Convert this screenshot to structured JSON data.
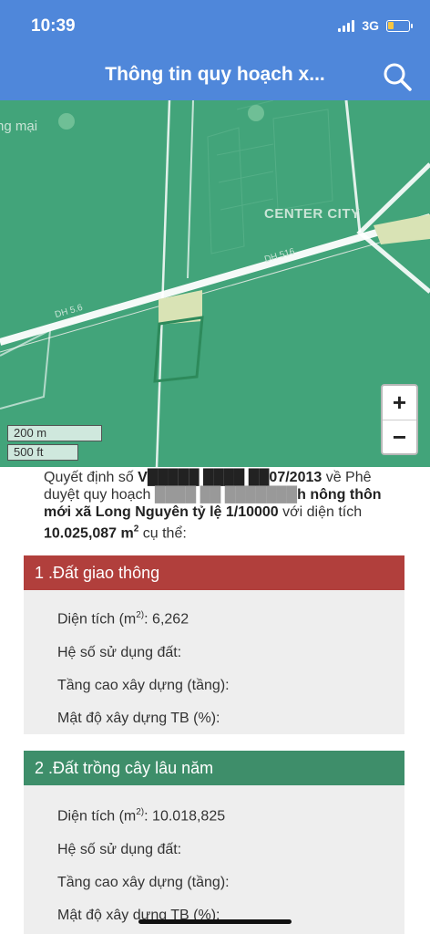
{
  "status": {
    "time": "10:39",
    "network": "3G"
  },
  "app_bar": {
    "title": "Thông tin quy hoạch x...",
    "search_icon": "search-icon"
  },
  "map": {
    "labels": {
      "place_left": "ng mại",
      "place_center": "CENTER CITY",
      "road_left": "DH 5.6",
      "road_right": "DH 516"
    },
    "zoom_in": "+",
    "zoom_out": "−",
    "scale_metric": "200 m",
    "scale_imperial": "500 ft",
    "colors": {
      "land": "#42a47a",
      "road": "#eef2ee",
      "parcel": "#d9e3b5"
    }
  },
  "description": {
    "part1": "Quyết định số ",
    "decision_no": "V█████ ████ ██07/2013",
    "part2": " về Phê duyệt quy hoạch ",
    "redacted": "████ ██ ███████",
    "plan_name": "h nông thôn mới xã Long Nguyên tỷ lệ 1/10000",
    "part3": " với diện tích ",
    "area": "10.025,087 m",
    "area_sup": "2",
    "part4": " cụ thể:"
  },
  "sections": [
    {
      "title": "1 .Đất giao thông",
      "color": "#b13f3c",
      "area_label": "Diện tích (m",
      "area_sup": "2)",
      "area_value": ": 6,262",
      "land_use_coef": "Hệ số sử dụng đất:",
      "floors": "Tầng cao xây dựng (tầng):",
      "density": "Mật độ xây dựng TB (%):"
    },
    {
      "title": "2 .Đất trồng cây lâu năm",
      "color": "#3e8e6a",
      "area_label": "Diện tích (m",
      "area_sup": "2)",
      "area_value": ": 10.018,825",
      "land_use_coef": "Hệ số sử dụng đất:",
      "floors": "Tầng cao xây dựng (tầng):",
      "density": "Mật độ xây dựng TB (%):"
    }
  ]
}
